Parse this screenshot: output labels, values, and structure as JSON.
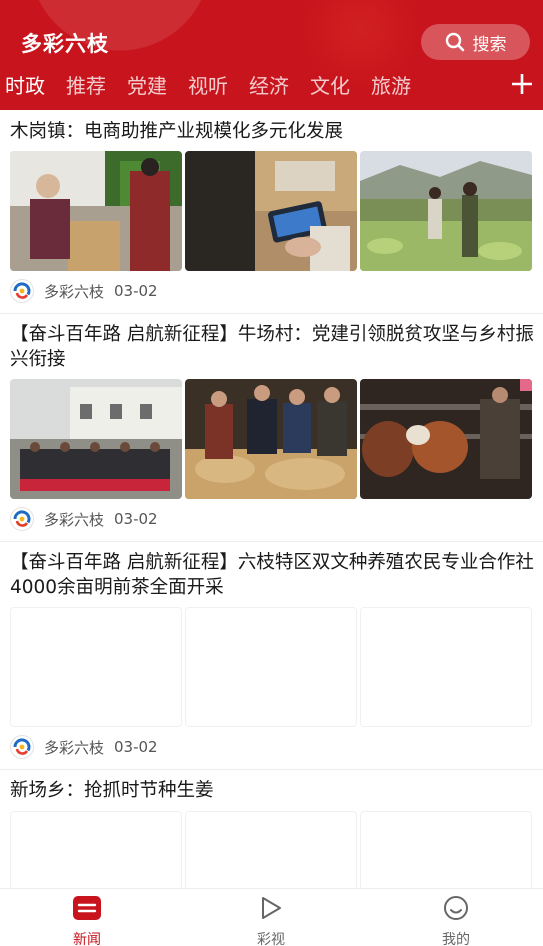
{
  "header": {
    "app_title": "多彩六枝",
    "search_label": "搜索",
    "tabs": [
      {
        "label": "时政",
        "active": true
      },
      {
        "label": "推荐"
      },
      {
        "label": "党建"
      },
      {
        "label": "视听"
      },
      {
        "label": "经济"
      },
      {
        "label": "文化"
      },
      {
        "label": "旅游"
      }
    ],
    "add_icon": "plus-icon"
  },
  "feed": {
    "articles": [
      {
        "title": "木岗镇：电商助推产业规模化多元化发展",
        "source": "多彩六枝",
        "date": "03-02",
        "images": [
          "woman-packing-boxes",
          "phone-scanning-barcode",
          "farmers-in-cabbage-field"
        ]
      },
      {
        "title": "【奋斗百年路 启航新征程】牛场村：党建引领脱贫攻坚与乡村振兴衔接",
        "source": "多彩六枝",
        "date": "03-02",
        "images": [
          "villagers-meeting-outdoors",
          "officials-inspecting-ginger",
          "cattle-in-barn"
        ]
      },
      {
        "title": "【奋斗百年路 启航新征程】六枝特区双文种养殖农民专业合作社4000余亩明前茶全面开采",
        "source": "多彩六枝",
        "date": "03-02",
        "images": [
          "blank",
          "blank",
          "blank"
        ]
      },
      {
        "title": "新场乡：抢抓时节种生姜",
        "images": [
          "blank",
          "blank",
          "blank"
        ]
      }
    ]
  },
  "bottom_nav": [
    {
      "label": "新闻",
      "icon": "news-icon",
      "active": true
    },
    {
      "label": "彩视",
      "icon": "play-icon"
    },
    {
      "label": "我的",
      "icon": "smile-icon"
    }
  ],
  "colors": {
    "brand": "#c8141c",
    "text": "#1a1a1a",
    "meta": "#555555"
  }
}
